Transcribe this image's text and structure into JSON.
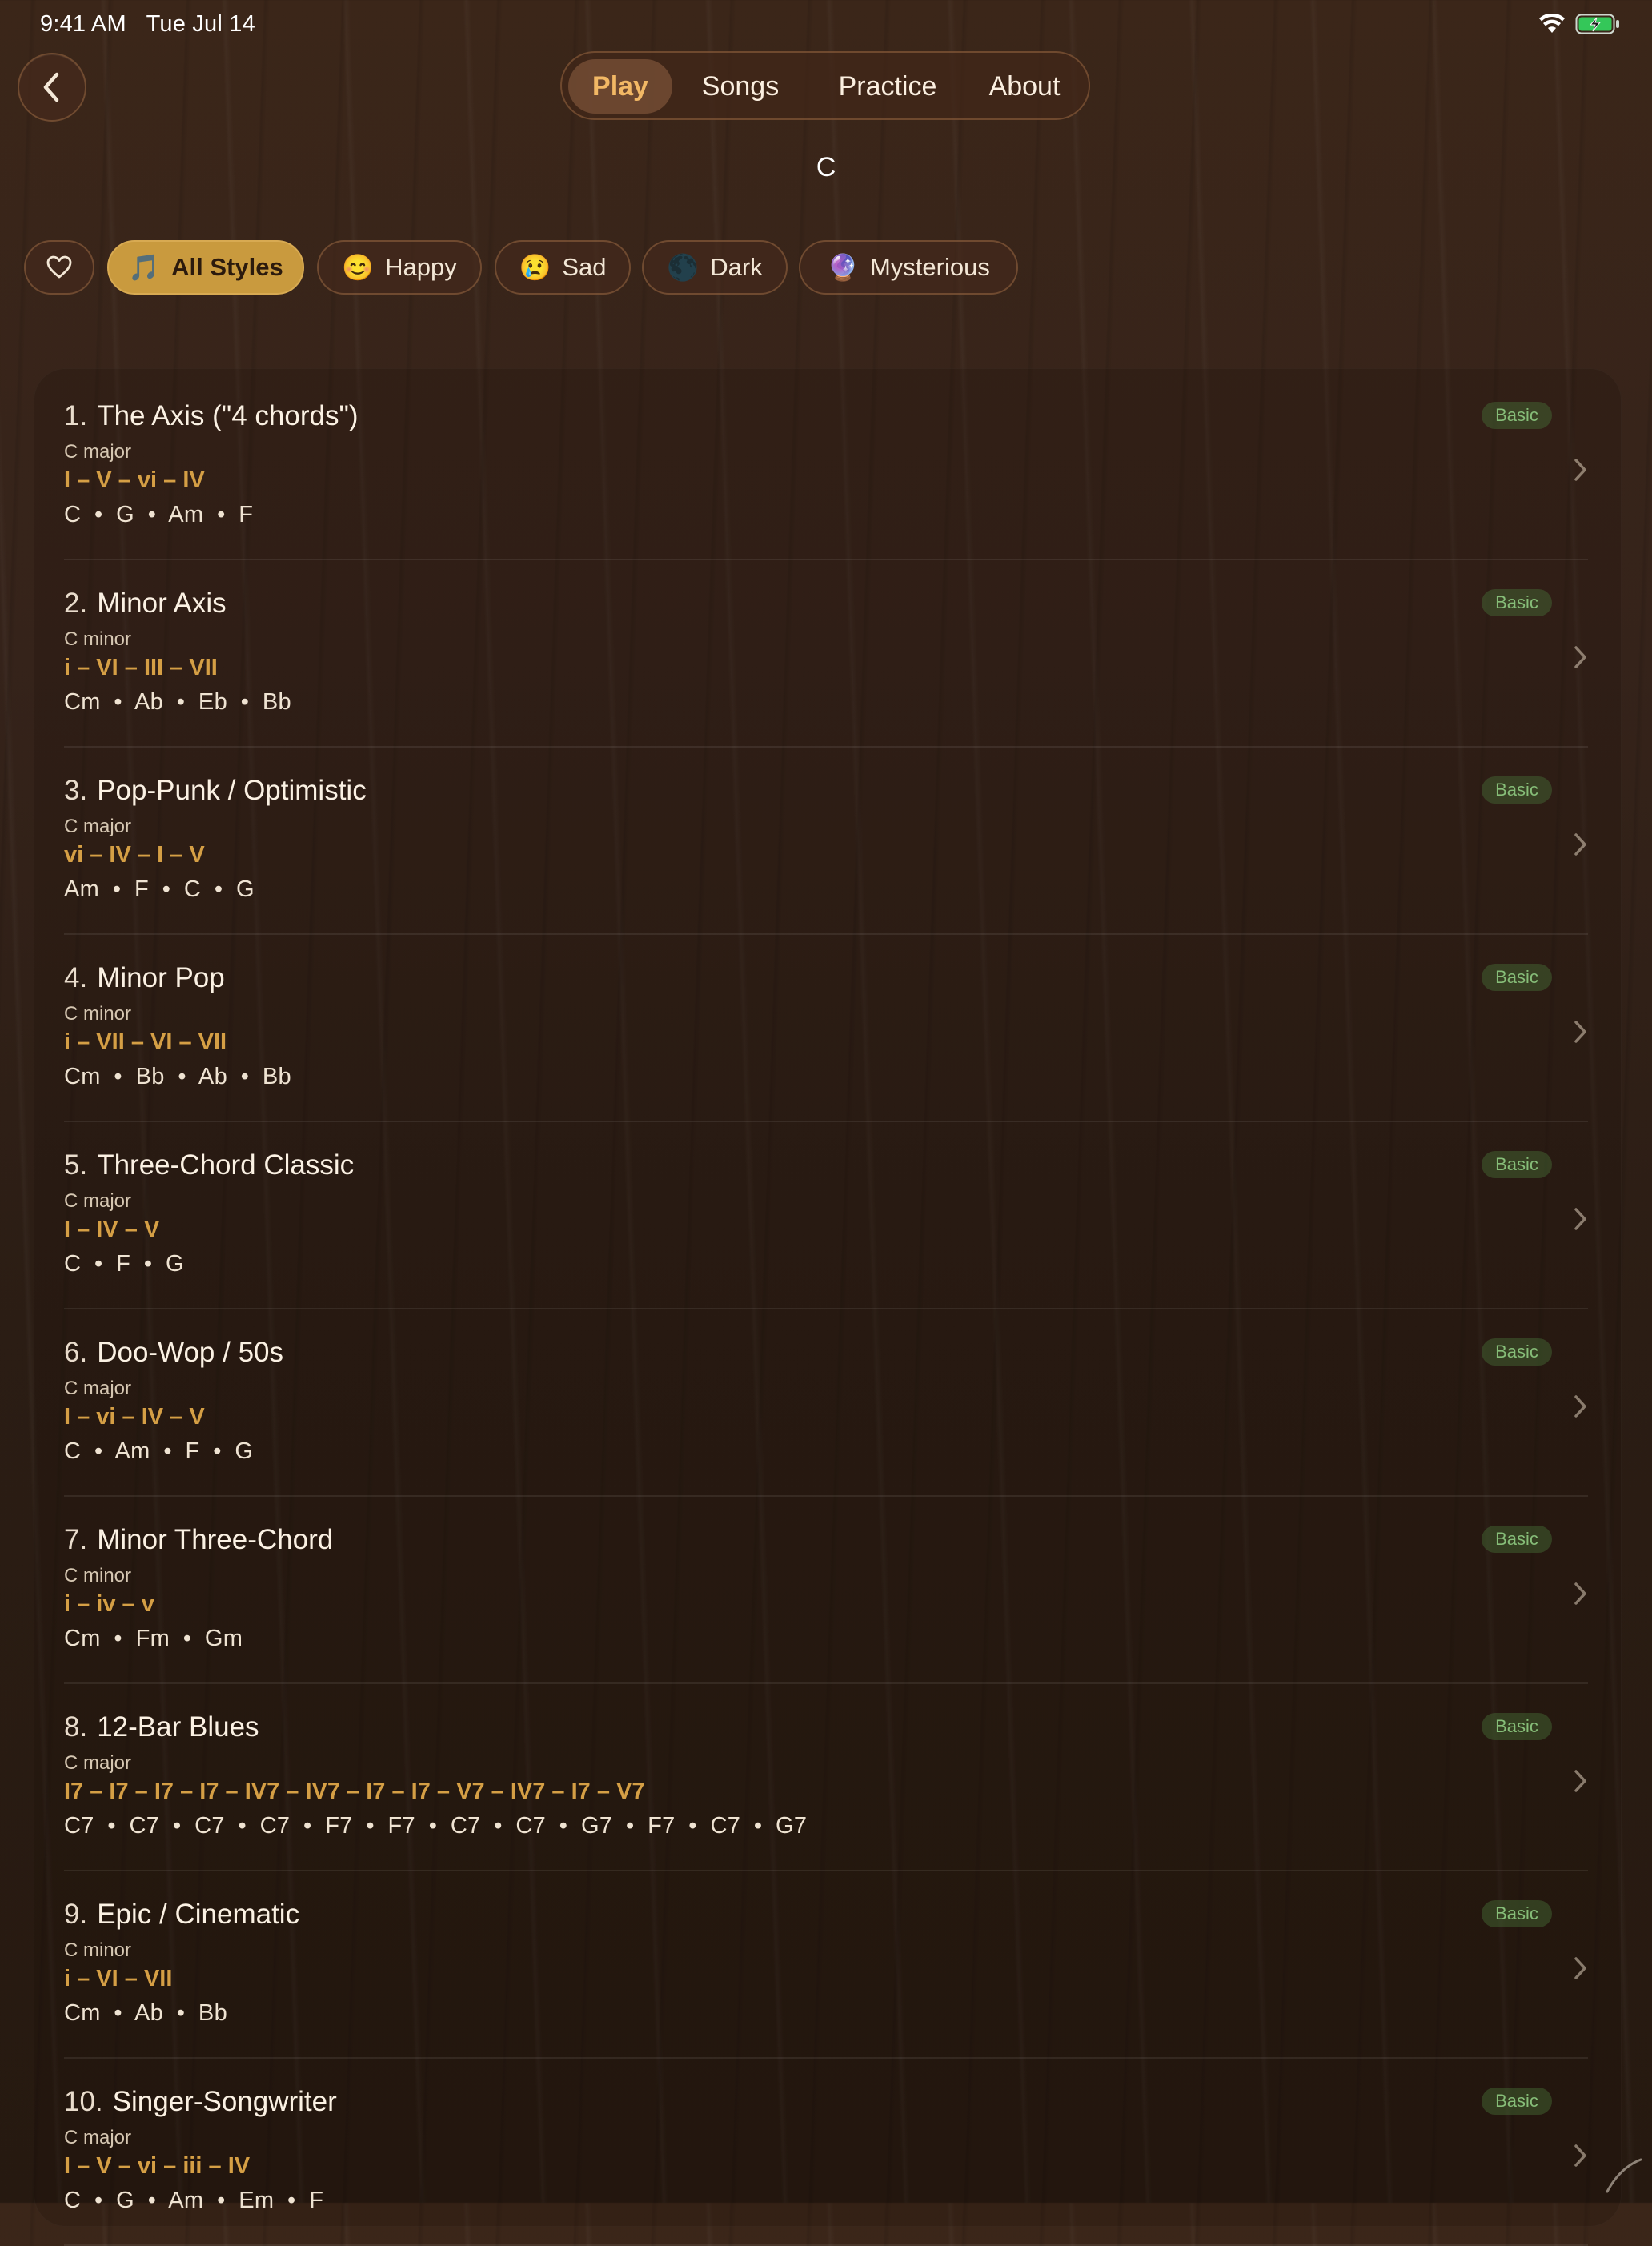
{
  "status": {
    "time": "9:41 AM",
    "date": "Tue Jul 14"
  },
  "tabs": [
    {
      "label": "Play",
      "active": true
    },
    {
      "label": "Songs",
      "active": false
    },
    {
      "label": "Practice",
      "active": false
    },
    {
      "label": "About",
      "active": false
    }
  ],
  "key_label": "C",
  "filters": {
    "favorites_icon": "heart-icon",
    "chips": [
      {
        "emoji": "🎵",
        "label": "All Styles",
        "active": true
      },
      {
        "emoji": "😊",
        "label": "Happy",
        "active": false
      },
      {
        "emoji": "😢",
        "label": "Sad",
        "active": false
      },
      {
        "emoji": "🌑",
        "label": "Dark",
        "active": false
      },
      {
        "emoji": "🔮",
        "label": "Mysterious",
        "active": false
      }
    ]
  },
  "progressions": [
    {
      "num": "1.",
      "name": "The Axis (\"4 chords\")",
      "key": "C major",
      "roman": "I – V – vi – IV",
      "chords": "C  •  G  •  Am  •  F",
      "badge": "Basic"
    },
    {
      "num": "2.",
      "name": "Minor Axis",
      "key": "C minor",
      "roman": "i – VI – III – VII",
      "chords": "Cm  •  Ab  •  Eb  •  Bb",
      "badge": "Basic"
    },
    {
      "num": "3.",
      "name": "Pop-Punk / Optimistic",
      "key": "C major",
      "roman": "vi – IV – I – V",
      "chords": "Am  •  F  •  C  •  G",
      "badge": "Basic"
    },
    {
      "num": "4.",
      "name": "Minor Pop",
      "key": "C minor",
      "roman": "i – VII – VI – VII",
      "chords": "Cm  •  Bb  •  Ab  •  Bb",
      "badge": "Basic"
    },
    {
      "num": "5.",
      "name": "Three-Chord Classic",
      "key": "C major",
      "roman": "I – IV – V",
      "chords": "C  •  F  •  G",
      "badge": "Basic"
    },
    {
      "num": "6.",
      "name": "Doo-Wop / 50s",
      "key": "C major",
      "roman": "I – vi – IV – V",
      "chords": "C  •  Am  •  F  •  G",
      "badge": "Basic"
    },
    {
      "num": "7.",
      "name": "Minor Three-Chord",
      "key": "C minor",
      "roman": "i – iv – v",
      "chords": "Cm  •  Fm  •  Gm",
      "badge": "Basic"
    },
    {
      "num": "8.",
      "name": "12-Bar Blues",
      "key": "C major",
      "roman": "I7 – I7 – I7 – I7 – IV7 – IV7 – I7 – I7 – V7 – IV7 – I7 – V7",
      "chords": "C7  •  C7  •  C7  •  C7  •  F7  •  F7  •  C7  •  C7  •  G7  •  F7  •  C7  •  G7",
      "badge": "Basic"
    },
    {
      "num": "9.",
      "name": "Epic / Cinematic",
      "key": "C minor",
      "roman": "i – VI – VII",
      "chords": "Cm  •  Ab  •  Bb",
      "badge": "Basic"
    },
    {
      "num": "10.",
      "name": "Singer-Songwriter",
      "key": "C major",
      "roman": "I – V – vi – iii – IV",
      "chords": "C  •  G  •  Am  •  Em  •  F",
      "badge": "Basic"
    }
  ],
  "colors": {
    "accent": "#d59f45",
    "tab_active_text": "#f2b865",
    "chip_active_bg": "#c99a3e",
    "badge_text": "#86bd78"
  }
}
